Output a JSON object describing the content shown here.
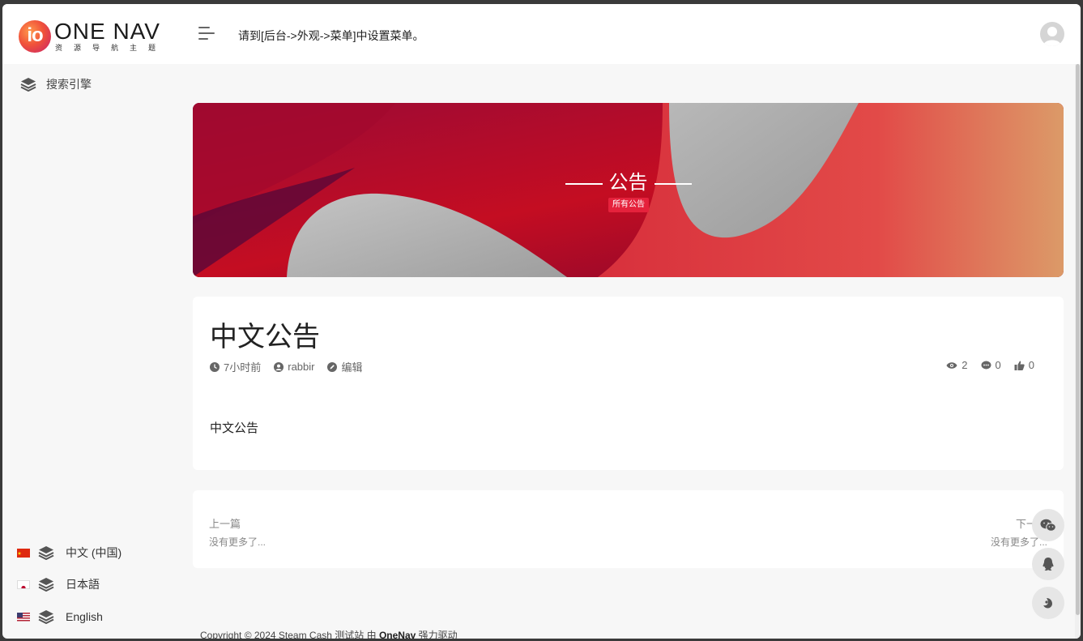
{
  "header": {
    "logo_mark": "io",
    "logo_title": "ONE NAV",
    "logo_subtitle": "资源导航主题",
    "menu_hint": "请到[后台->外观->菜单]中设置菜单。"
  },
  "sidebar": {
    "search_label": "搜索引擎",
    "languages": [
      {
        "label": "中文 (中国)",
        "flag": "cn-flag-icon"
      },
      {
        "label": "日本語",
        "flag": "jp-flag-icon"
      },
      {
        "label": "English",
        "flag": "us-flag-icon"
      }
    ]
  },
  "banner": {
    "title": "公告",
    "badge": "所有公告"
  },
  "post": {
    "title": "中文公告",
    "time": "7小时前",
    "author": "rabbir",
    "edit": "编辑",
    "views": "2",
    "comments": "0",
    "likes": "0",
    "body": "中文公告"
  },
  "post_nav": {
    "prev_label": "上一篇",
    "prev_sub": "没有更多了...",
    "next_label": "下一篇",
    "next_sub": "没有更多了..."
  },
  "footer": {
    "prefix": "Copyright © 2024 Steam Cash 测试站 由 ",
    "brand": "OneNav",
    "suffix": " 强力驱动"
  },
  "colors": {
    "accent": "#e5223c",
    "background": "#f7f7f7"
  }
}
